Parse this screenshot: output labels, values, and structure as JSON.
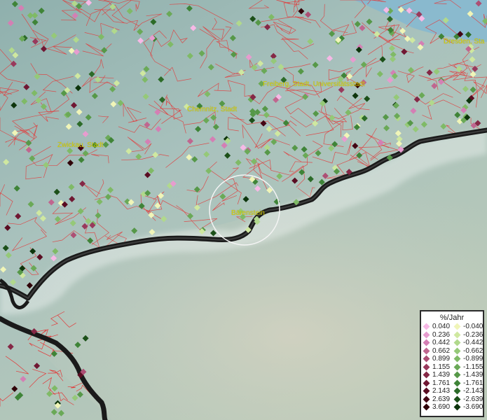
{
  "map": {
    "labels": [
      {
        "text": "Dresden, Sta"
      },
      {
        "text": "Freiberg, Stadt, Universitätsstadt"
      },
      {
        "text": "Chemnitz, Stadt"
      },
      {
        "text": "Zwickau, Stadt"
      },
      {
        "text": "Bärenstein"
      }
    ]
  },
  "legend": {
    "title": "%/Jahr",
    "positive": [
      "0.040",
      "0.236",
      "0.442",
      "0.662",
      "0.899",
      "1.155",
      "1.439",
      "1.761",
      "2.143",
      "2.639",
      "3.690"
    ],
    "negative": [
      "-0.040",
      "-0.236",
      "-0.442",
      "-0.662",
      "-0.899",
      "-1.155",
      "-1.439",
      "-1.761",
      "-2.143",
      "-2.639",
      "-3.690"
    ],
    "positive_colors": [
      "#f7b8e6",
      "#e79ccf",
      "#d47fb4",
      "#c0668f",
      "#ad4f74",
      "#99395c",
      "#852846",
      "#701833",
      "#5a0d22",
      "#440614",
      "#300309"
    ],
    "negative_colors": [
      "#f0f5b8",
      "#cfe8a0",
      "#b1d98c",
      "#95c978",
      "#7fba66",
      "#6aa957",
      "#569848",
      "#3f8438",
      "#2c6b28",
      "#1c5019",
      "#0d350c"
    ]
  }
}
